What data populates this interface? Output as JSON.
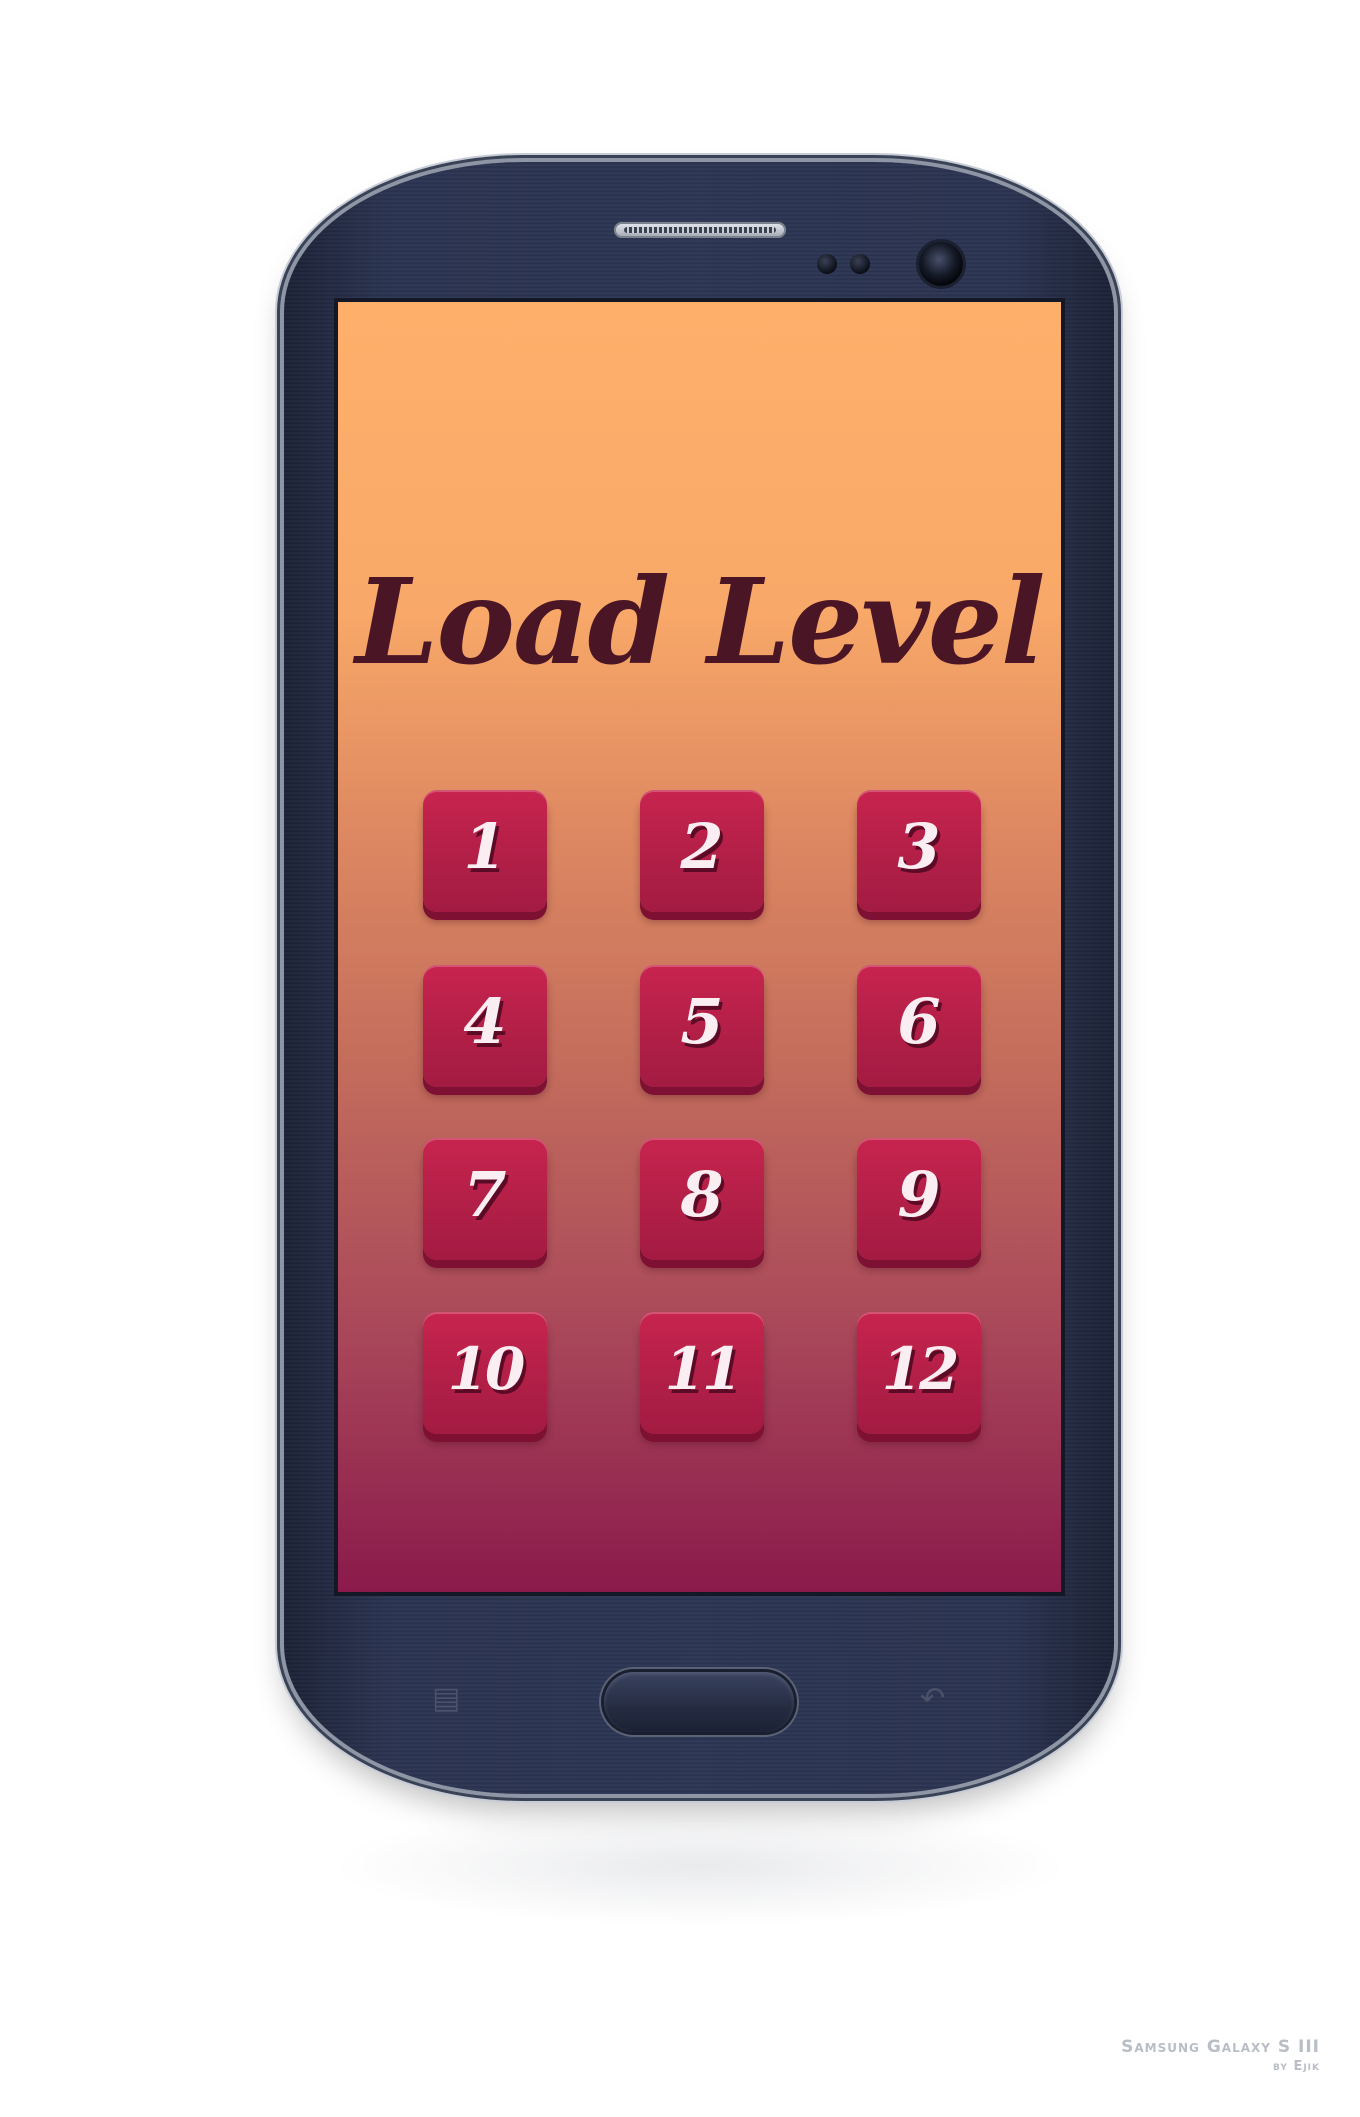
{
  "screen": {
    "title": "Load Level",
    "levels": [
      "1",
      "2",
      "3",
      "4",
      "5",
      "6",
      "7",
      "8",
      "9",
      "10",
      "11",
      "12"
    ]
  },
  "device": {
    "nav_menu_icon": "menu-icon",
    "nav_back_icon": "back-icon"
  },
  "caption": {
    "model": "Samsung Galaxy S III",
    "author": "by Ejik"
  },
  "colors": {
    "title": "#4a1525",
    "button": "#b21f47",
    "gradient_top": "#feb06b",
    "gradient_bottom": "#8a1a4b"
  }
}
